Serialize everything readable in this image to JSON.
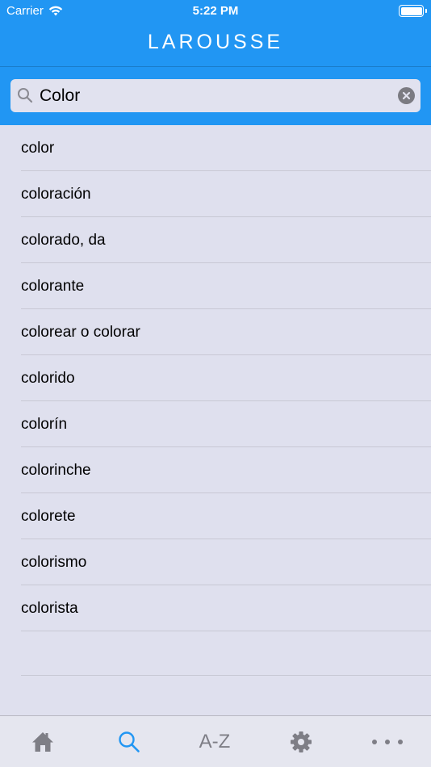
{
  "status_bar": {
    "carrier": "Carrier",
    "time": "5:22 PM"
  },
  "header": {
    "brand": "LAROUSSE"
  },
  "search": {
    "value": "Color"
  },
  "results": [
    "color",
    "coloración",
    "colorado, da",
    "colorante",
    "colorear o colorar",
    "colorido",
    "colorín",
    "colorinche",
    "colorete",
    "colorismo",
    "colorista"
  ],
  "tabs": {
    "home_icon": "home-icon",
    "search_icon": "search-icon",
    "az_label": "A-Z",
    "settings_icon": "gear-icon",
    "more_icon": "more-icon"
  },
  "colors": {
    "accent": "#2196f3",
    "active_tab": "#2196f3",
    "inactive_tab": "#7e7e86"
  }
}
